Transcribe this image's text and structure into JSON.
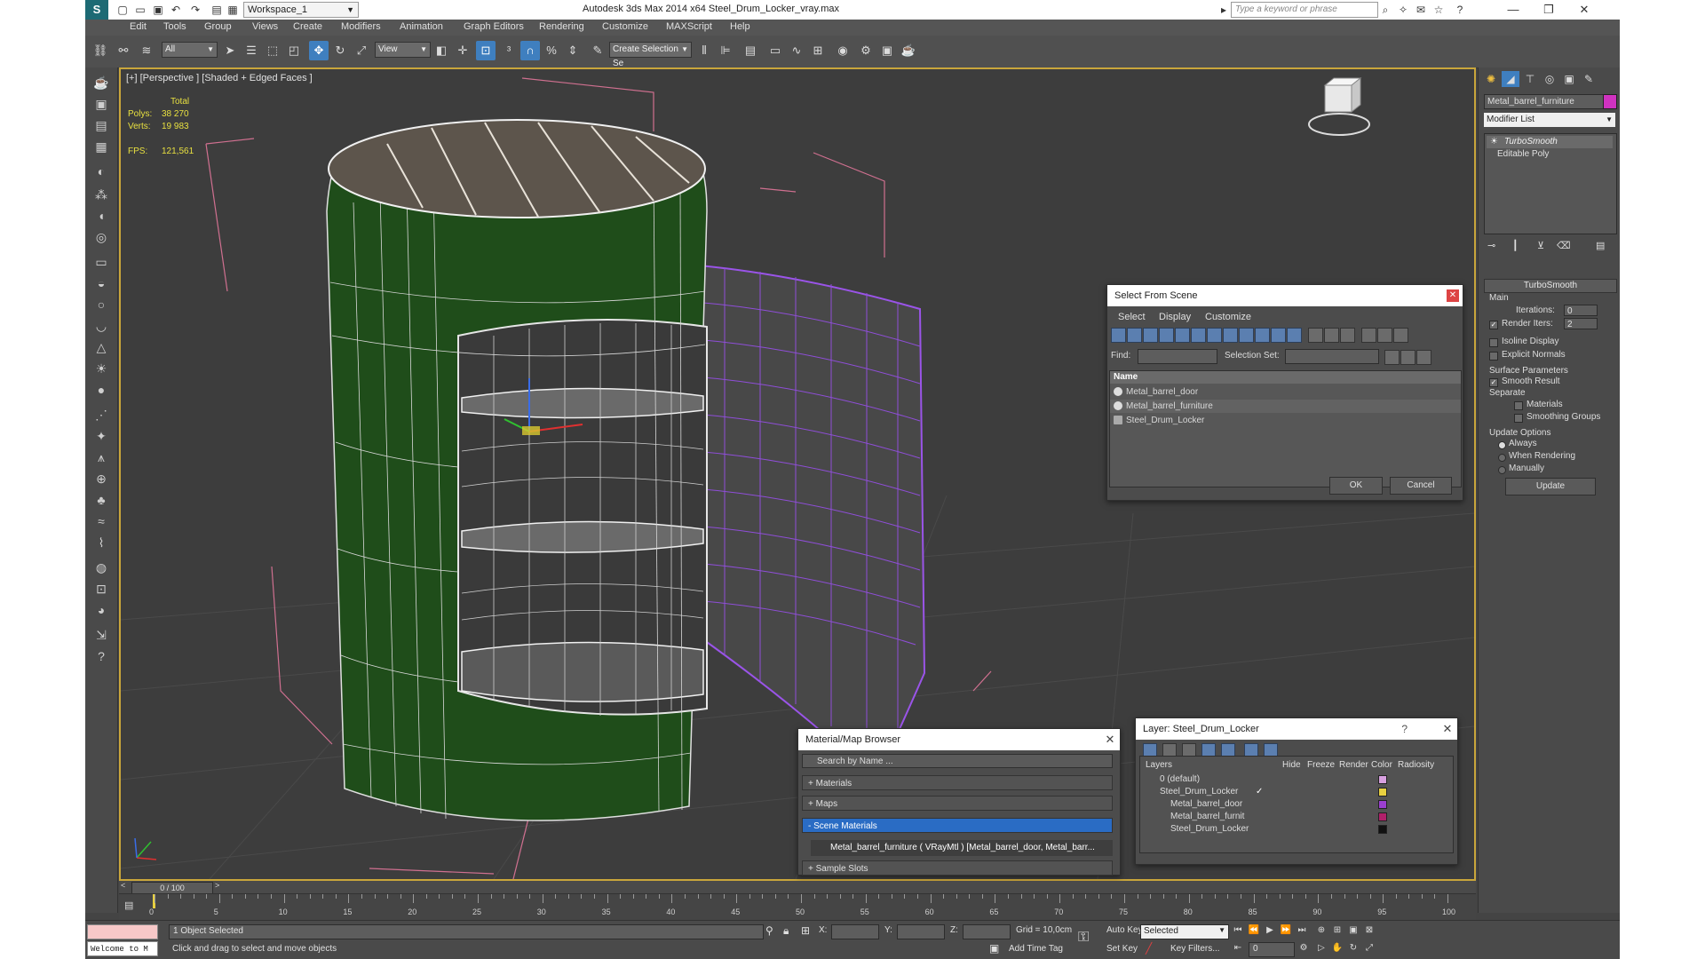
{
  "window": {
    "title": "Autodesk 3ds Max  2014 x64      Steel_Drum_Locker_vray.max",
    "workspace": "Workspace_1",
    "search_placeholder": "Type a keyword or phrase"
  },
  "menu": [
    "Edit",
    "Tools",
    "Group",
    "Views",
    "Create",
    "Modifiers",
    "Animation",
    "Graph Editors",
    "Rendering",
    "Customize",
    "MAXScript",
    "Help"
  ],
  "toolbar": {
    "filter_value": "All",
    "coord_value": "View",
    "selection_set_placeholder": "Create Selection Se"
  },
  "viewport": {
    "label": "[+] [Perspective ] [Shaded + Edged Faces ]",
    "stats": {
      "total_label": "Total",
      "polys_label": "Polys:",
      "polys_value": "38 270",
      "verts_label": "Verts:",
      "verts_value": "19 983",
      "fps_label": "FPS:",
      "fps_value": "121,561"
    }
  },
  "select_from_scene": {
    "title": "Select From Scene",
    "tabs": [
      "Select",
      "Display",
      "Customize"
    ],
    "find_label": "Find:",
    "selection_set_label": "Selection Set:",
    "column_name": "Name",
    "items": [
      "Metal_barrel_door",
      "Metal_barrel_furniture",
      "Steel_Drum_Locker"
    ],
    "ok_label": "OK",
    "cancel_label": "Cancel"
  },
  "material_browser": {
    "title": "Material/Map Browser",
    "search_placeholder": "Search by Name ...",
    "groups": [
      "+ Materials",
      "+ Maps",
      "- Scene Materials",
      "+ Sample Slots"
    ],
    "scene_material": "Metal_barrel_furniture ( VRayMtl ) [Metal_barrel_door, Metal_barr..."
  },
  "layer_dialog": {
    "title": "Layer: Steel_Drum_Locker",
    "help": "?",
    "columns": [
      "Layers",
      "Hide",
      "Freeze",
      "Render",
      "Color",
      "Radiosity"
    ],
    "rows": [
      {
        "name": "0 (default)",
        "color": "#d8a0e0"
      },
      {
        "name": "Steel_Drum_Locker",
        "color": "#e8d040"
      },
      {
        "name": "Metal_barrel_door",
        "color": "#9b3fd0"
      },
      {
        "name": "Metal_barrel_furnit",
        "color": "#b0206a"
      },
      {
        "name": "Steel_Drum_Locker",
        "color": "#111111"
      }
    ]
  },
  "command_panel": {
    "object_name": "Metal_barrel_furniture",
    "object_color": "#d032c0",
    "modifier_list": "Modifier List",
    "stack": [
      "TurboSmooth",
      "Editable Poly"
    ],
    "turbosmooth": {
      "title": "TurboSmooth",
      "main": "Main",
      "iterations_label": "Iterations:",
      "iterations_value": "0",
      "render_iters_label": "Render Iters:",
      "render_iters_value": "2",
      "isoline": "Isoline Display",
      "explicit": "Explicit Normals",
      "surface": "Surface Parameters",
      "smooth_result": "Smooth Result",
      "separate": "Separate",
      "materials": "Materials",
      "smoothing_groups": "Smoothing Groups",
      "update_options": "Update Options",
      "always": "Always",
      "when_rendering": "When Rendering",
      "manually": "Manually",
      "update_btn": "Update"
    }
  },
  "timeline": {
    "frame": "0 / 100",
    "ticks": [
      "0",
      "5",
      "10",
      "15",
      "20",
      "25",
      "30",
      "35",
      "40",
      "45",
      "50",
      "55",
      "60",
      "65",
      "70",
      "75",
      "80",
      "85",
      "90",
      "95",
      "100"
    ]
  },
  "status": {
    "welcome": "Welcome to M",
    "objects_selected": "1 Object Selected",
    "prompt": "Click and drag to select and move objects",
    "x_label": "X:",
    "y_label": "Y:",
    "z_label": "Z:",
    "grid": "Grid = 10,0cm",
    "add_time_tag": "Add Time Tag",
    "auto_key": "Auto Key",
    "set_key": "Set Key",
    "selected_value": "Selected",
    "key_filters": "Key Filters...",
    "frame_value": "0"
  }
}
